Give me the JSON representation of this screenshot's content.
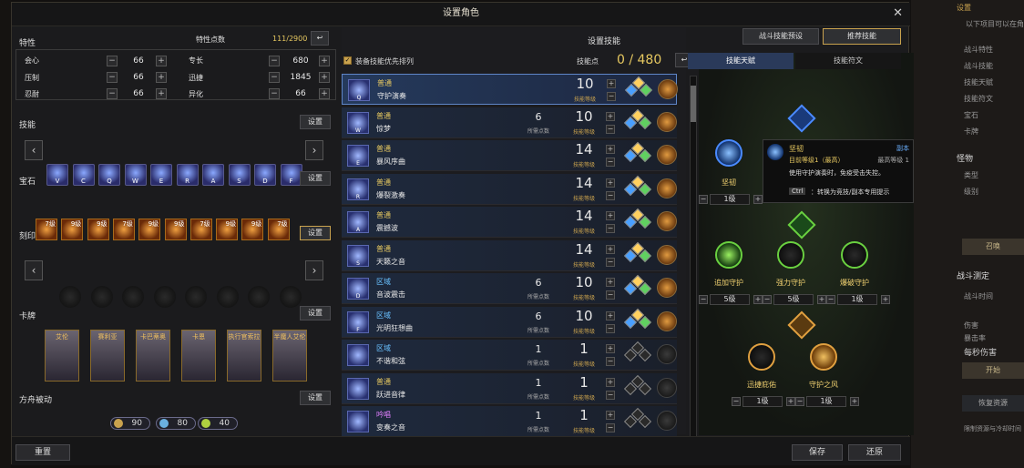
{
  "title": "设置角色",
  "right_panel": {
    "top": "设置",
    "hint": "以下项目可以在角",
    "items": [
      "战斗特性",
      "战斗技能",
      "技能天赋",
      "技能符文",
      "宝石",
      "卡牌"
    ],
    "monster": "怪物",
    "type": "类型",
    "level": "级别",
    "summon": "召唤",
    "battle_test": "战斗测定",
    "battle_time": "战斗时间",
    "damage": "伤害",
    "crit": "暴击率",
    "dps": "每秒伤害",
    "start": "开始",
    "restore": "恢复资源",
    "limit": "限制资源与冷却时间"
  },
  "traits": {
    "title": "特性",
    "points_label": "特性点数",
    "points": "111/2900",
    "stats": [
      {
        "name": "会心",
        "val": "66"
      },
      {
        "name": "压制",
        "val": "66"
      },
      {
        "name": "忍耐",
        "val": "66"
      },
      {
        "name": "专长",
        "val": "680"
      },
      {
        "name": "迅捷",
        "val": "1845"
      },
      {
        "name": "异化",
        "val": "66"
      }
    ]
  },
  "skills": {
    "title": "技能",
    "btn": "设置",
    "keys": [
      "V",
      "C",
      "Q",
      "W",
      "E",
      "R",
      "A",
      "S",
      "D",
      "F"
    ]
  },
  "gems": {
    "title": "宝石",
    "btn": "设置",
    "levels": [
      "7级",
      "9级",
      "9级",
      "7级",
      "9级",
      "9级",
      "7级",
      "9级",
      "9级",
      "7级"
    ]
  },
  "engraving": {
    "title": "刻印",
    "btn": "设置"
  },
  "cards": {
    "title": "卡牌",
    "btn": "设置",
    "names": [
      "艾伦",
      "赛利亚",
      "卡巴蒂奥",
      "卡恩",
      "执行官索拉",
      "半魔人艾伦"
    ]
  },
  "ark": {
    "title": "方舟被动",
    "btn": "设置",
    "vals": [
      "90",
      "80",
      "40"
    ]
  },
  "skill_setup": {
    "title": "设置技能",
    "preset_btn": "战斗技能预设",
    "recommend_btn": "推荐技能",
    "checkbox": "装备技能优先排列",
    "pts_label": "技能点",
    "pts": "0 / 480",
    "lbl_cost": "所需点数",
    "lbl_level": "技能等级",
    "rows": [
      {
        "type": "普通",
        "name": "守护演奏",
        "key": "Q",
        "cost": "",
        "level": "10"
      },
      {
        "type": "普通",
        "name": "惊梦",
        "key": "W",
        "cost": "6",
        "level": "10"
      },
      {
        "type": "普通",
        "name": "暴风序曲",
        "key": "E",
        "cost": "",
        "level": "14"
      },
      {
        "type": "普通",
        "name": "爆裂激奏",
        "key": "R",
        "cost": "",
        "level": "14"
      },
      {
        "type": "普通",
        "name": "震撼波",
        "key": "A",
        "cost": "",
        "level": "14"
      },
      {
        "type": "普通",
        "name": "天籁之音",
        "key": "S",
        "cost": "",
        "level": "14"
      },
      {
        "type": "区域",
        "name": "音波震击",
        "key": "D",
        "cost": "6",
        "level": "10"
      },
      {
        "type": "区域",
        "name": "光明狂想曲",
        "key": "F",
        "cost": "6",
        "level": "10"
      },
      {
        "type": "区域",
        "name": "不谐和弦",
        "key": "",
        "cost": "1",
        "level": "1"
      },
      {
        "type": "普通",
        "name": "跃进音律",
        "key": "",
        "cost": "1",
        "level": "1"
      },
      {
        "type": "吟唱",
        "name": "变奏之音",
        "key": "",
        "cost": "1",
        "level": "1"
      }
    ]
  },
  "tripod": {
    "tab1": "技能天赋",
    "tab2": "技能符文",
    "n1": "坚韧",
    "n1lv": "1级",
    "n2": "追加守护",
    "n2lv": "5级",
    "n3": "强力守护",
    "n3lv": "5级",
    "n4": "爆破守护",
    "n4lv": "1级",
    "n5": "迅捷庇佑",
    "n5lv": "1级",
    "n6": "守护之风",
    "n6lv": "1级",
    "tt": {
      "name": "坚韧",
      "tag": "副本",
      "level": "目前等级1（最高）",
      "max": "最高等级 1",
      "desc": "使用守护演奏时，免疫受击失控。",
      "ctrl": "Ctrl",
      "ctrl_desc": "：转换为竞技/副本专用提示"
    }
  },
  "footer": {
    "reset": "重置",
    "save": "保存",
    "restore": "还原"
  }
}
